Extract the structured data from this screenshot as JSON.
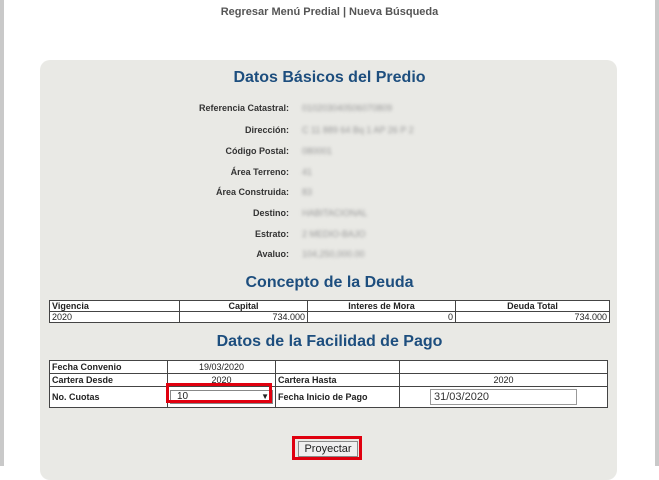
{
  "nav": {
    "link1": "Regresar Menú Predial",
    "separator": "|",
    "link2": "Nueva Búsqueda"
  },
  "datos_basicos": {
    "title": "Datos Básicos del Predio",
    "fields": [
      {
        "label": "Referencia Catastral:",
        "value": "010203040506070809"
      },
      {
        "label": "Dirección:",
        "value": "C 11 889 64 Bq 1 AP 26 P 2"
      },
      {
        "label": "Código Postal:",
        "value": "080001"
      },
      {
        "label": "Área Terreno:",
        "value": "41"
      },
      {
        "label": "Área Construida:",
        "value": "83"
      },
      {
        "label": "Destino:",
        "value": "HABITACIONAL"
      },
      {
        "label": "Estrato:",
        "value": "2 MEDIO-BAJO"
      },
      {
        "label": "Avaluo:",
        "value": "104,250,000.00"
      }
    ]
  },
  "concepto": {
    "title": "Concepto de la Deuda",
    "headers": [
      "Vigencia",
      "Capital",
      "Interes de Mora",
      "Deuda Total"
    ],
    "rows": [
      [
        "2020",
        "734.000",
        "0",
        "734.000"
      ]
    ]
  },
  "facilidad": {
    "title": "Datos de la Facilidad de Pago",
    "fecha_convenio_label": "Fecha Convenio",
    "fecha_convenio_value": "19/03/2020",
    "cartera_desde_label": "Cartera Desde",
    "cartera_desde_value": "2020",
    "cartera_hasta_label": "Cartera Hasta",
    "cartera_hasta_value": "2020",
    "cuotas_label": "No. Cuotas",
    "cuotas_value": "10",
    "fecha_inicio_label": "Fecha Inicio de Pago",
    "fecha_inicio_value": "31/03/2020"
  },
  "actions": {
    "proyectar": "Proyectar"
  },
  "colors": {
    "title": "#1d4e7e",
    "highlight": "#e0000f",
    "panel": "#e9e9e5"
  }
}
